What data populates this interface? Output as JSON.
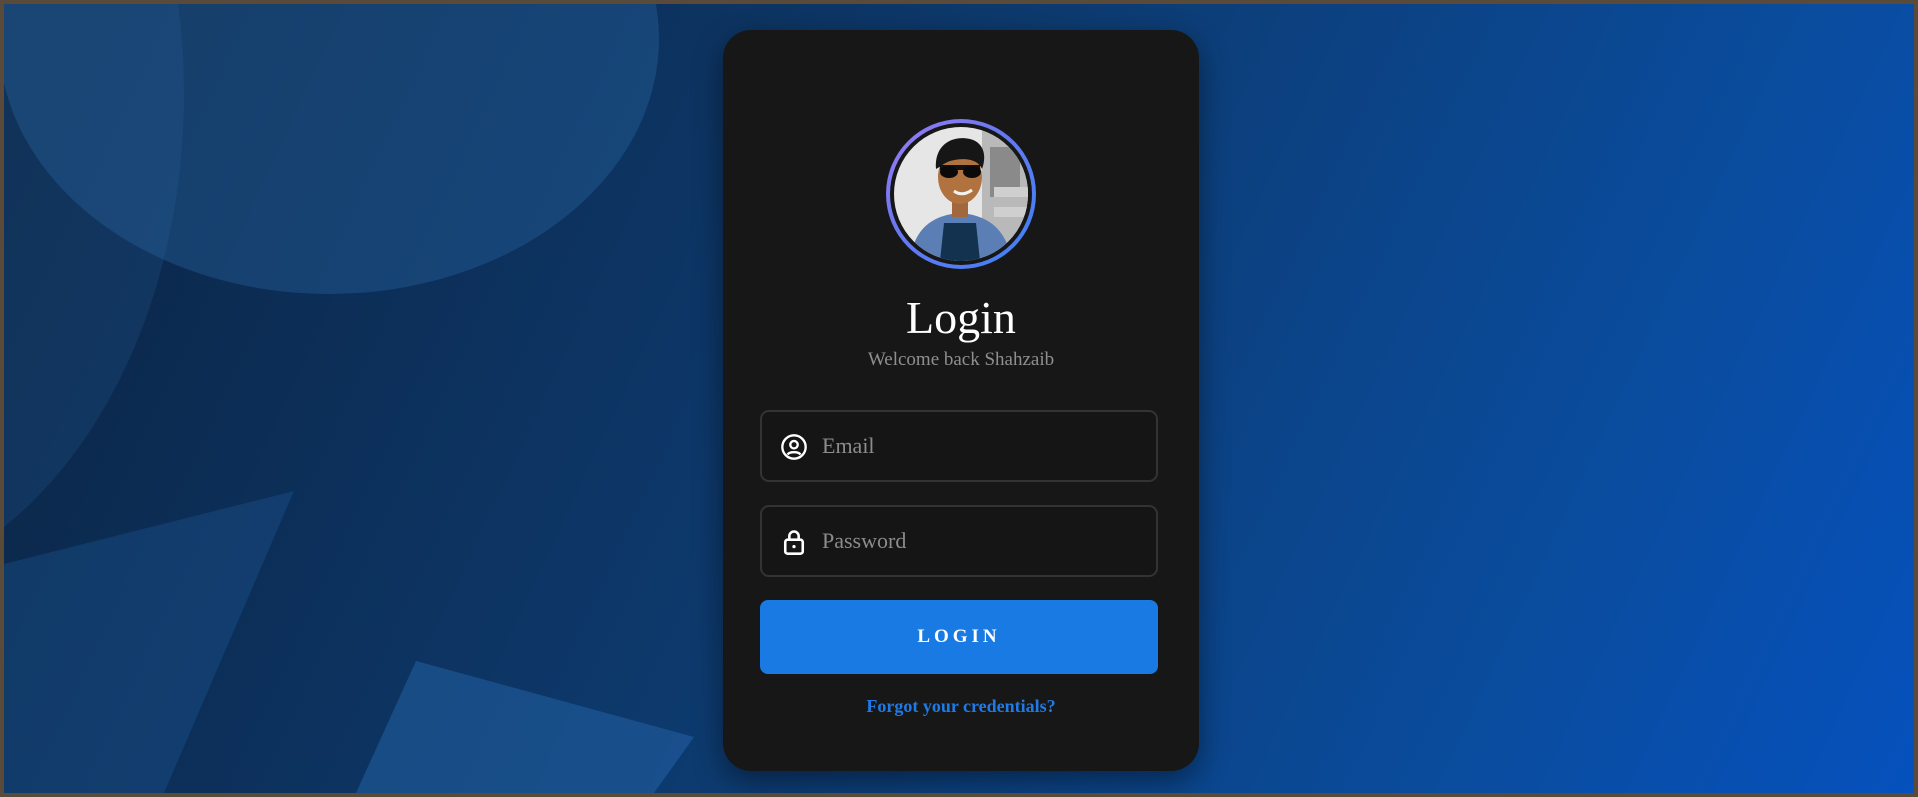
{
  "login_card": {
    "title": "Login",
    "subtitle": "Welcome back Shahzaib",
    "email_field": {
      "placeholder": "Email",
      "value": "",
      "icon": "user-circle-icon"
    },
    "password_field": {
      "placeholder": "Password",
      "value": "",
      "icon": "lock-icon"
    },
    "login_button": "LOGIN",
    "forgot_link": "Forgot your credentials?"
  },
  "colors": {
    "background_start": "#0c2443",
    "background_end": "#0551bd",
    "card": "#171717",
    "accent": "#1a7ae4",
    "avatar_ring": "#6a78f0"
  }
}
